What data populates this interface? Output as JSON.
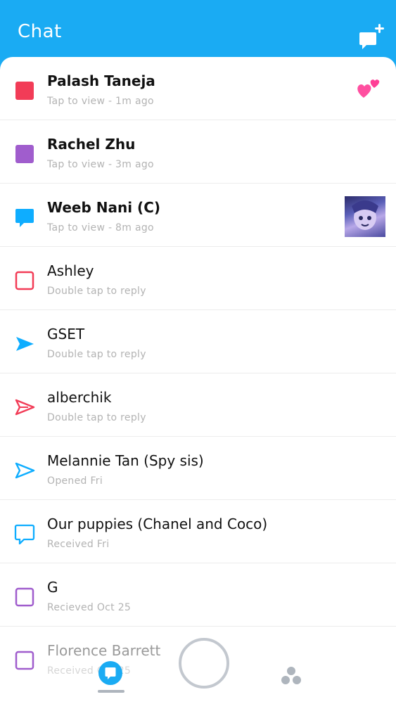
{
  "header": {
    "title": "Chat",
    "new_chat_icon": "new-chat-icon"
  },
  "colors": {
    "brand_blue": "#1aabf3",
    "snap_red": "#f23c57",
    "snap_purple": "#a05dcd",
    "chat_blue": "#0eadff",
    "muted_text": "#b3b3b3"
  },
  "chats": [
    {
      "name": "Palash Taneja",
      "status": "Tap to view - 1m ago",
      "icon": "unopened-snap-red"
    },
    {
      "name": "Rachel Zhu",
      "status": "Tap to view - 3m ago",
      "icon": "unopened-snap-purple"
    },
    {
      "name": "Weeb Nani (C)",
      "status": "Tap to view - 8m ago",
      "icon": "unopened-chat-blue"
    },
    {
      "name": "Ashley",
      "status": "Double tap to reply",
      "icon": "opened-snap-red"
    },
    {
      "name": "GSET",
      "status": "Double tap to reply",
      "icon": "sent-chat-blue"
    },
    {
      "name": "alberchik",
      "status": "Double tap to reply",
      "icon": "opened-snap-red-arrow"
    },
    {
      "name": "Melannie Tan (Spy sis)",
      "status": "Opened Fri",
      "icon": "opened-sent-blue"
    },
    {
      "name": "Our puppies (Chanel and Coco)",
      "status": "Received Fri",
      "icon": "received-chat-blue"
    },
    {
      "name": "G",
      "status": "Recieved Oct 25",
      "icon": "received-snap-purple"
    },
    {
      "name": "Florence Barrett",
      "status": "Received Oct 25",
      "icon": "received-snap-purple"
    }
  ],
  "bottom_nav": {
    "chat_icon": "chat-icon",
    "capture_icon": "camera-capture-icon",
    "discover_icon": "discover-icon"
  }
}
